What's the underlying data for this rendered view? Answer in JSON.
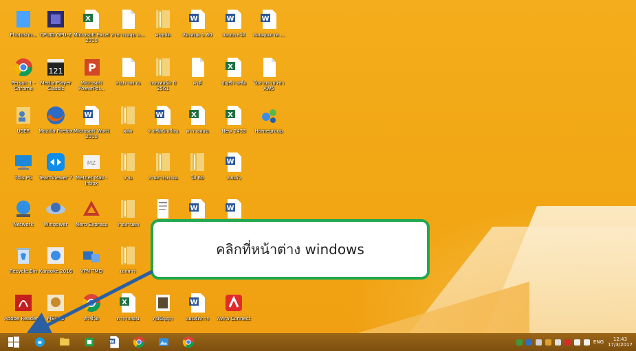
{
  "desktop": {
    "icons": [
      {
        "label": "Photoshn...",
        "icon": "app-icon"
      },
      {
        "label": "CPUID GPU-Z",
        "icon": "gpu-icon"
      },
      {
        "label": "Microsoft Excel 2010",
        "icon": "excel-icon"
      },
      {
        "label": "สาธารณสุข ล...",
        "icon": "file-icon"
      },
      {
        "label": "ครูชนิด",
        "icon": "folder-icon"
      },
      {
        "label": "ห้องสมุด 1.60",
        "icon": "word-icon"
      },
      {
        "label": "สอบประวัติ",
        "icon": "word-icon"
      },
      {
        "label": "สอบคุณภาพ ...",
        "icon": "word-icon"
      },
      {
        "label": "Person 1 - Chrome",
        "icon": "chrome-icon"
      },
      {
        "label": "Media Player Classic",
        "icon": "media-player-icon"
      },
      {
        "label": "Microsoft PowerPoi...",
        "icon": "powerpoint-icon"
      },
      {
        "label": "สรุปรายงาน",
        "icon": "file-icon"
      },
      {
        "label": "แบบฟอร์ม ปี 2561",
        "icon": "folder-icon"
      },
      {
        "label": "ครูดี",
        "icon": "file-icon"
      },
      {
        "label": "บัญชีรายชื่อ",
        "icon": "excel-icon"
      },
      {
        "label": "ใบงานรายวิชา AW5",
        "icon": "file-icon"
      },
      {
        "label": "USER",
        "icon": "user-folder-icon"
      },
      {
        "label": "Mozilla Firefox",
        "icon": "firefox-icon"
      },
      {
        "label": "Microsoft Word 2010",
        "icon": "word-icon"
      },
      {
        "label": "ผลิต",
        "icon": "folder-icon"
      },
      {
        "label": "รายชื่อนักเรียน",
        "icon": "word-icon"
      },
      {
        "label": "ตารางสอน",
        "icon": "excel-icon"
      },
      {
        "label": "New 2433",
        "icon": "excel-icon"
      },
      {
        "label": "Homegroup",
        "icon": "homegroup-icon"
      },
      {
        "label": "This PC",
        "icon": "pc-icon"
      },
      {
        "label": "TeamViewer 7",
        "icon": "teamviewer-icon"
      },
      {
        "label": "Metnet Mail - Inbox",
        "icon": "mail-icon"
      },
      {
        "label": "งาน",
        "icon": "folder-icon"
      },
      {
        "label": "งานสารบรรณ",
        "icon": "folder-icon"
      },
      {
        "label": "ใส่ 60",
        "icon": "folder-icon"
      },
      {
        "label": "ส่งแล้ว",
        "icon": "word-icon"
      },
      {
        "label": "Network",
        "icon": "network-icon"
      },
      {
        "label": "Wingower",
        "icon": "wingower-icon"
      },
      {
        "label": "Nero Express",
        "icon": "nero-icon"
      },
      {
        "label": "รายงานผล",
        "icon": "folder-icon"
      },
      {
        "label": "",
        "icon": "document-icon"
      },
      {
        "label": "",
        "icon": "word-icon"
      },
      {
        "label": "",
        "icon": "word-icon"
      },
      {
        "label": "Recycle Bin",
        "icon": "recycle-bin-icon"
      },
      {
        "label": "Karaoke 2016",
        "icon": "karaoke-icon"
      },
      {
        "label": "VPN TMD",
        "icon": "vpn-icon"
      },
      {
        "label": "เอกสาร",
        "icon": "folder-icon"
      },
      {
        "label": "Adobe Reader 9",
        "icon": "adobe-reader-icon"
      },
      {
        "label": "METEO",
        "icon": "meteo-icon"
      },
      {
        "label": "ตัวชี้วัด",
        "icon": "chrome-icon"
      },
      {
        "label": "ตารางสอน",
        "icon": "excel-icon"
      },
      {
        "label": "ภูมิปัญญา",
        "icon": "image-icon"
      },
      {
        "label": "แผนจัดการ",
        "icon": "word-icon"
      },
      {
        "label": "Avira Connect",
        "icon": "avira-icon"
      }
    ]
  },
  "callout": {
    "text": "คลิกที่หน้าต่าง windows"
  },
  "taskbar": {
    "start_icon": "windows-logo-icon",
    "apps": [
      {
        "icon": "internet-explorer-icon"
      },
      {
        "icon": "file-explorer-icon"
      },
      {
        "icon": "store-icon"
      },
      {
        "icon": "word-icon"
      },
      {
        "icon": "chrome-icon"
      },
      {
        "icon": "photos-icon"
      },
      {
        "icon": "chrome-icon"
      }
    ],
    "language": "ENG",
    "time": "12:43",
    "date": "17/3/2017"
  },
  "colors": {
    "callout_border": "#21a850",
    "arrow": "#2c5fa0",
    "wallpaper": "#f2a714"
  }
}
